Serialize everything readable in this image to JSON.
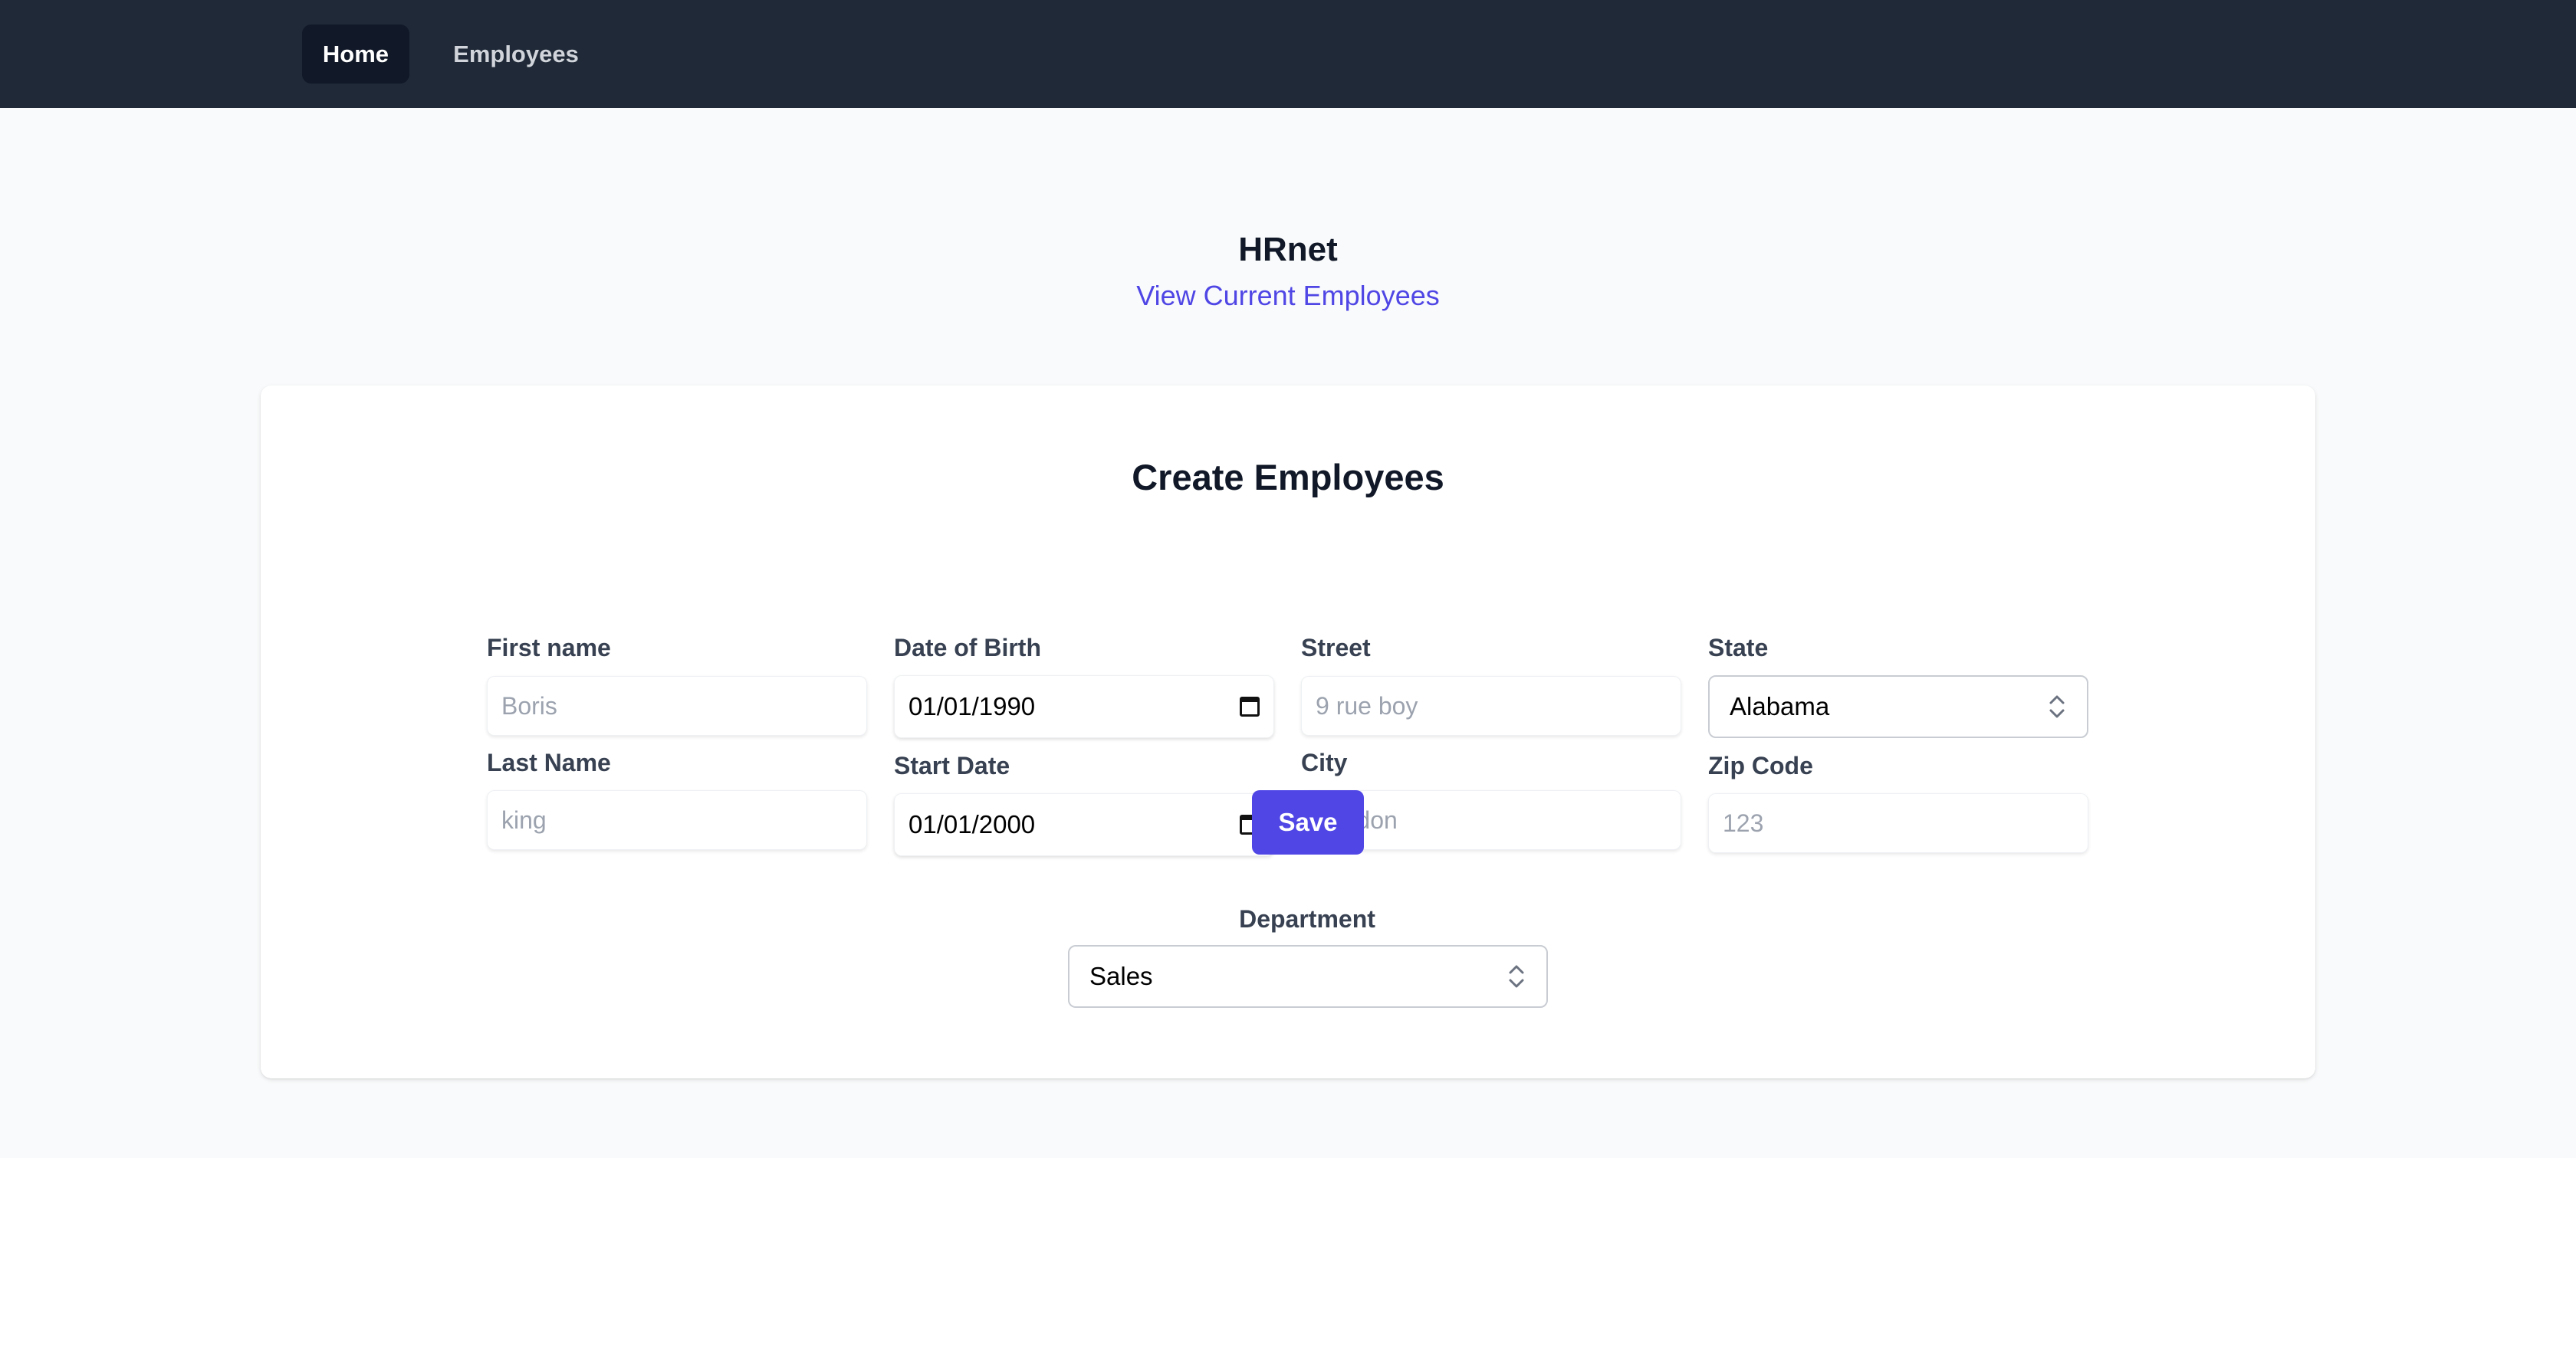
{
  "nav": {
    "items": [
      {
        "label": "Home",
        "active": true
      },
      {
        "label": "Employees",
        "active": false
      }
    ]
  },
  "header": {
    "title": "HRnet",
    "link_label": "View Current Employees"
  },
  "form": {
    "title": "Create Employees",
    "first_name": {
      "label": "First name",
      "placeholder": "Boris",
      "value": ""
    },
    "last_name": {
      "label": "Last Name",
      "placeholder": "king",
      "value": ""
    },
    "date_of_birth": {
      "label": "Date of Birth",
      "value": "01/01/1990"
    },
    "start_date": {
      "label": "Start Date",
      "value": "01/01/2000"
    },
    "street": {
      "label": "Street",
      "placeholder": "9 rue boy",
      "value": ""
    },
    "city": {
      "label": "City",
      "placeholder": "London",
      "value": ""
    },
    "state": {
      "label": "State",
      "selected": "Alabama"
    },
    "zip_code": {
      "label": "Zip Code",
      "placeholder": "123",
      "value": ""
    },
    "department": {
      "label": "Department",
      "selected": "Sales"
    },
    "save_label": "Save"
  },
  "colors": {
    "nav_bg": "#1f2937",
    "nav_active_bg": "#111827",
    "accent": "#4f46e5",
    "page_bg": "#f9fafb"
  },
  "icons": {
    "calendar": "calendar-icon",
    "select_arrows": "chevron-up-down-icon"
  }
}
